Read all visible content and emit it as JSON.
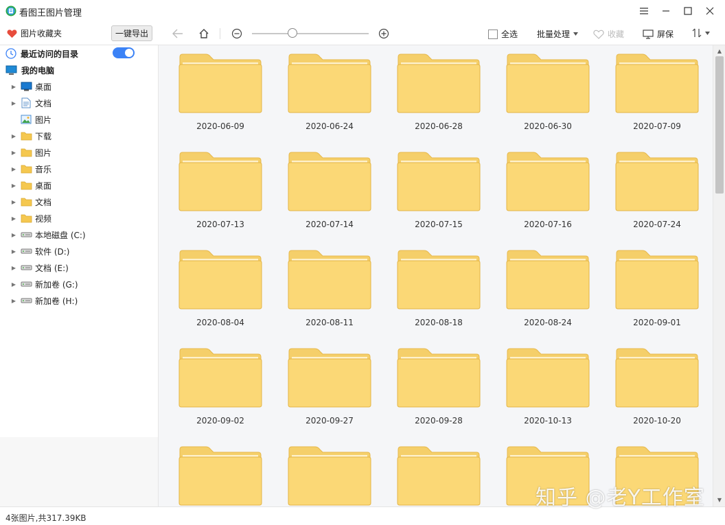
{
  "app": {
    "title": "看图王图片管理"
  },
  "toolbar": {
    "favorites_label": "图片收藏夹",
    "export_label": "一键导出",
    "select_all_label": "全选",
    "batch_label": "批量处理",
    "collect_label": "收藏",
    "screen_label": "屏保"
  },
  "sidebar": {
    "recent_label": "最近访问的目录",
    "recent_enabled": true,
    "my_computer_label": "我的电脑",
    "items": [
      {
        "label": "桌面",
        "icon": "desktop-icon",
        "expandable": true
      },
      {
        "label": "文档",
        "icon": "document-icon",
        "expandable": true
      },
      {
        "label": "图片",
        "icon": "picture-icon",
        "expandable": false
      },
      {
        "label": "下载",
        "icon": "folder-icon",
        "expandable": true
      },
      {
        "label": "图片",
        "icon": "folder-icon",
        "expandable": true
      },
      {
        "label": "音乐",
        "icon": "folder-icon",
        "expandable": true
      },
      {
        "label": "桌面",
        "icon": "folder-icon",
        "expandable": true
      },
      {
        "label": "文档",
        "icon": "folder-icon",
        "expandable": true
      },
      {
        "label": "视频",
        "icon": "folder-icon",
        "expandable": true
      },
      {
        "label": "本地磁盘 (C:)",
        "icon": "drive-icon",
        "expandable": true
      },
      {
        "label": "软件 (D:)",
        "icon": "drive-icon",
        "expandable": true
      },
      {
        "label": "文档 (E:)",
        "icon": "drive-icon",
        "expandable": true
      },
      {
        "label": "新加卷 (G:)",
        "icon": "drive-icon",
        "expandable": true
      },
      {
        "label": "新加卷 (H:)",
        "icon": "drive-icon",
        "expandable": true
      }
    ]
  },
  "folders": [
    "2020-06-09",
    "2020-06-24",
    "2020-06-28",
    "2020-06-30",
    "2020-07-09",
    "2020-07-13",
    "2020-07-14",
    "2020-07-15",
    "2020-07-16",
    "2020-07-24",
    "2020-08-04",
    "2020-08-11",
    "2020-08-18",
    "2020-08-24",
    "2020-09-01",
    "2020-09-02",
    "2020-09-27",
    "2020-09-28",
    "2020-10-13",
    "2020-10-20",
    "",
    "",
    "",
    "",
    ""
  ],
  "status": {
    "text": "4张图片,共317.39KB"
  },
  "watermark": "知乎 @老Y工作室",
  "colors": {
    "folder_back": "#f5cf6a",
    "folder_front": "#fbd876",
    "toggle": "#3b82f6",
    "heart": "#e74c3c"
  }
}
